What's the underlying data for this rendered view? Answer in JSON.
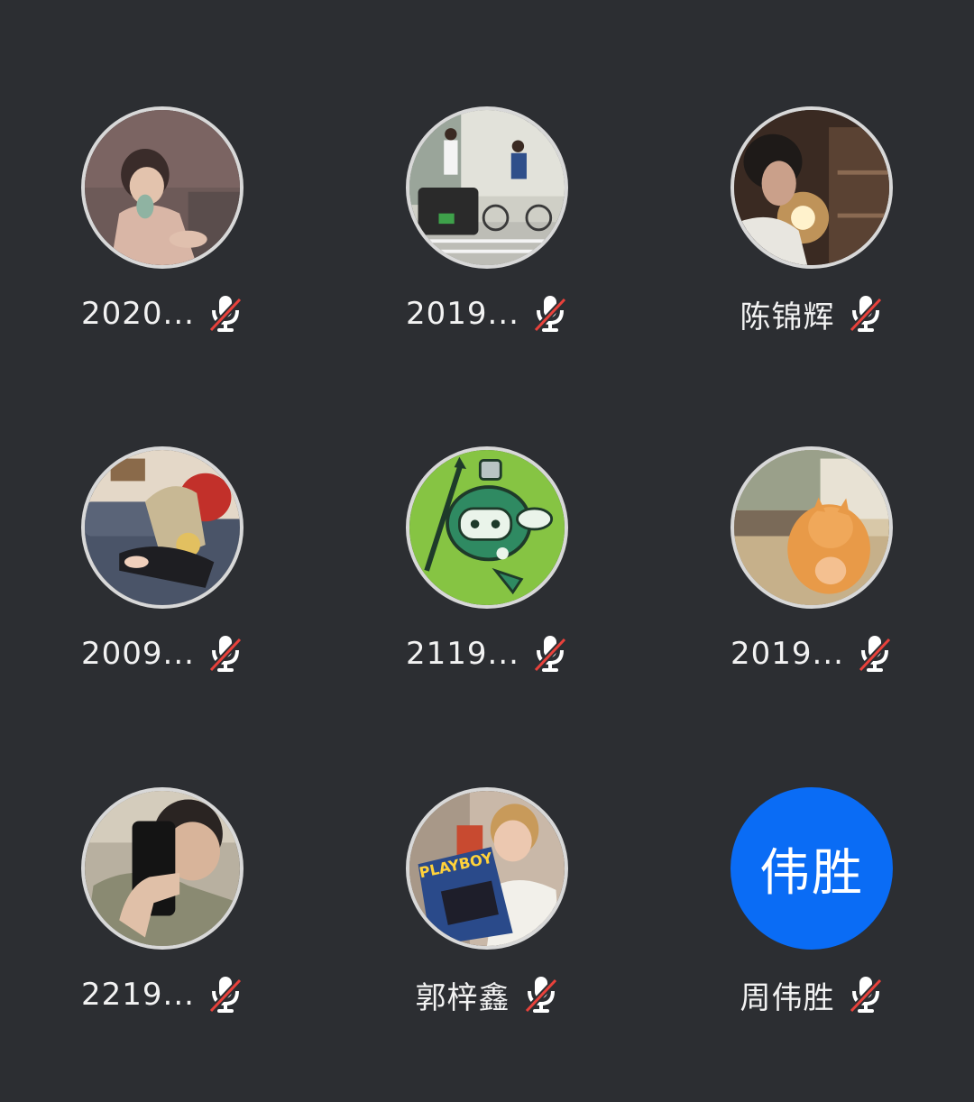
{
  "participants": [
    {
      "name": "2020...",
      "avatar": "photo-child-drinking",
      "muted": true
    },
    {
      "name": "2019...",
      "avatar": "photo-street-cyclist",
      "muted": true
    },
    {
      "name": "陈锦辉",
      "avatar": "photo-boy-lamp",
      "muted": true
    },
    {
      "name": "2009...",
      "avatar": "photo-anime-couch",
      "muted": true
    },
    {
      "name": "2119...",
      "avatar": "photo-green-robot-cartoon",
      "muted": true
    },
    {
      "name": "2019...",
      "avatar": "photo-orange-cat",
      "muted": true
    },
    {
      "name": "2219...",
      "avatar": "photo-mirror-selfie",
      "muted": true
    },
    {
      "name": "郭梓鑫",
      "avatar": "photo-boy-reading-magazine",
      "muted": true
    },
    {
      "name": "周伟胜",
      "avatar_text": "伟胜",
      "avatar_color": "#0a6cf5",
      "muted": true
    }
  ],
  "magazine_title": "PLAYBOY",
  "colors": {
    "background": "#2c2e32",
    "name_text": "#f2f2f2",
    "mic_icon": "#ffffff",
    "mute_slash": "#e8413b",
    "avatar_border": "#d8d8d8",
    "text_avatar_bg": "#0a6cf5"
  }
}
